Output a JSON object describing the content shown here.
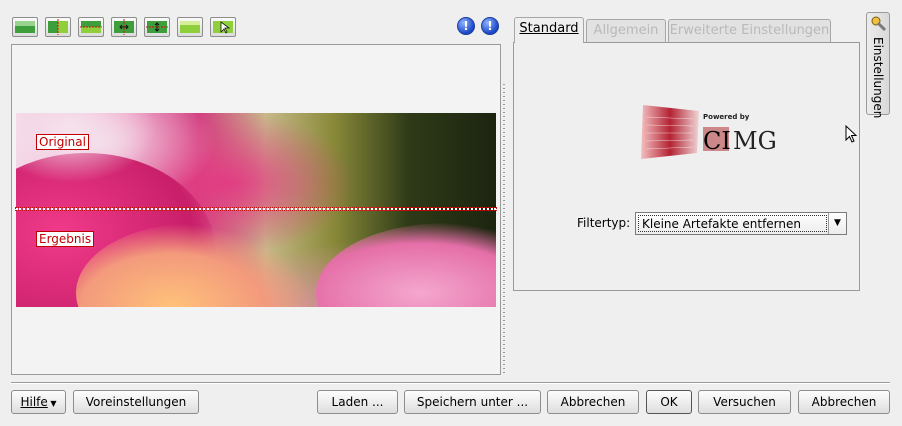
{
  "toolbar": {
    "preview_modes": [
      {
        "icon": "original-image-icon"
      },
      {
        "icon": "vertical-split-icon"
      },
      {
        "icon": "horizontal-split-icon"
      },
      {
        "icon": "vertical-split-duplicate-icon"
      },
      {
        "icon": "horizontal-split-duplicate-icon"
      },
      {
        "icon": "target-image-icon"
      },
      {
        "icon": "mouse-over-icon"
      }
    ],
    "info_buttons": [
      {
        "icon": "overexposure-indicator-icon",
        "glyph": "!"
      },
      {
        "icon": "underexposure-indicator-icon",
        "glyph": "!"
      }
    ]
  },
  "preview": {
    "label_top": "Original",
    "label_bottom": "Ergebnis",
    "colors": {
      "label": "#c00000",
      "split_line": "#c01010"
    }
  },
  "tabs": [
    {
      "label": "Standard",
      "active": true
    },
    {
      "label": "Allgemein",
      "active": false
    },
    {
      "label": "Erweiterte Einstellungen",
      "active": false
    }
  ],
  "logo": {
    "powered_by": "Powered by",
    "name": "CImg"
  },
  "filter": {
    "label": "Filtertyp:",
    "value": "Kleine Artefakte entfernen"
  },
  "side_panel": {
    "label": "Einstellungen",
    "icon": "wrench-settings-icon"
  },
  "buttons": {
    "help": "Hilfe",
    "defaults": "Voreinstellungen",
    "load": "Laden ...",
    "save_as": "Speichern unter ...",
    "cancel_left": "Abbrechen",
    "ok": "OK",
    "try": "Versuchen",
    "cancel": "Abbrechen"
  }
}
